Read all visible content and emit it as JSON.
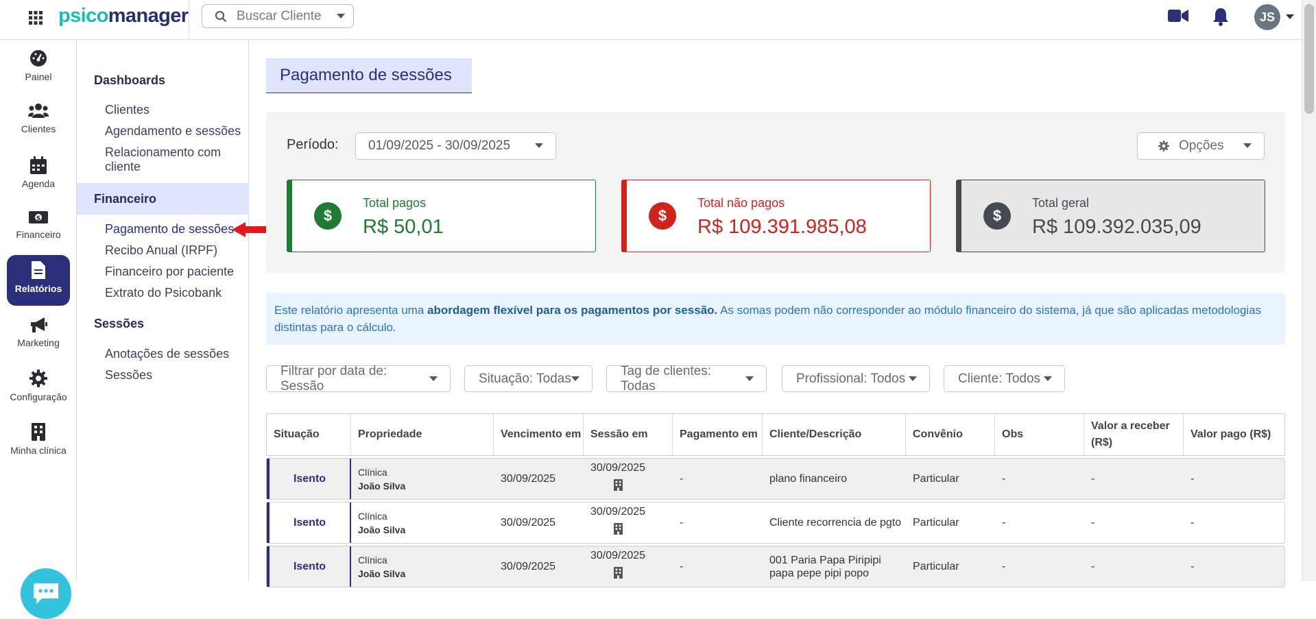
{
  "brand": {
    "part1": "psico",
    "part2": "manager"
  },
  "search": {
    "placeholder": "Buscar Cliente"
  },
  "user": {
    "initials": "JS"
  },
  "rail": [
    {
      "label": "Painel",
      "icon": "dashboard-gauge-icon"
    },
    {
      "label": "Clientes",
      "icon": "users-icon"
    },
    {
      "label": "Agenda",
      "icon": "calendar-icon"
    },
    {
      "label": "Financeiro",
      "icon": "money-icon"
    },
    {
      "label": "Relatórios",
      "icon": "report-file-icon",
      "active": true
    },
    {
      "label": "Marketing",
      "icon": "megaphone-icon"
    },
    {
      "label": "Configuração",
      "icon": "gear-icon"
    },
    {
      "label": "Minha clínica",
      "icon": "building-icon"
    }
  ],
  "subnav": {
    "dashboards": {
      "title": "Dashboards",
      "items": [
        "Clientes",
        "Agendamento e sessões",
        "Relacionamento com cliente"
      ]
    },
    "financeiro": {
      "title": "Financeiro",
      "items": [
        "Pagamento de sessões",
        "Recibo Anual (IRPF)",
        "Financeiro por paciente",
        "Extrato do Psicobank"
      ]
    },
    "sessoes": {
      "title": "Sessões",
      "items": [
        "Anotações de sessões",
        "Sessões"
      ]
    }
  },
  "page": {
    "title": "Pagamento de sessões"
  },
  "period": {
    "label": "Período:",
    "value": "01/09/2025 - 30/09/2025"
  },
  "options": {
    "label": "Opções"
  },
  "summary": {
    "paid": {
      "label": "Total pagos",
      "value": "R$ 50,01",
      "color": "#1e7b34"
    },
    "unpaid": {
      "label": "Total não pagos",
      "value": "R$ 109.391.985,08",
      "color": "#d0241b"
    },
    "total": {
      "label": "Total geral",
      "value": "R$ 109.392.035,09",
      "color": "#444a4f"
    }
  },
  "info": {
    "part1": "Este relatório apresenta uma ",
    "bold": "abordagem flexível para os pagamentos por sessão.",
    "part2": " As somas podem não corresponder ao módulo financeiro do sistema, já que são aplicadas metodologias distintas para o cálculo."
  },
  "filters": [
    "Filtrar por data de: Sessão",
    "Situação: Todas",
    "Tag de clientes: Todas",
    "Profissional: Todos",
    "Cliente: Todos"
  ],
  "table": {
    "headers": [
      "Situação",
      "Propriedade",
      "Vencimento em",
      "Sessão em",
      "Pagamento em",
      "Cliente/Descrição",
      "Convênio",
      "Obs",
      "Valor a receber (R$)",
      "Valor pago (R$)"
    ],
    "rows": [
      {
        "situacao": "Isento",
        "prop_type": "Clínica",
        "prop_name": "João Silva",
        "vencimento": "30/09/2025",
        "sessao": "30/09/2025",
        "pagamento": "-",
        "cliente": "plano financeiro",
        "convenio": "Particular",
        "obs": "-",
        "a_receber": "-",
        "pago": "-"
      },
      {
        "situacao": "Isento",
        "prop_type": "Clínica",
        "prop_name": "João Silva",
        "vencimento": "30/09/2025",
        "sessao": "30/09/2025",
        "pagamento": "-",
        "cliente": "Cliente recorrencia de pgto",
        "convenio": "Particular",
        "obs": "-",
        "a_receber": "-",
        "pago": "-"
      },
      {
        "situacao": "Isento",
        "prop_type": "Clínica",
        "prop_name": "João Silva",
        "vencimento": "30/09/2025",
        "sessao": "30/09/2025",
        "pagamento": "-",
        "cliente": "001 Paria Papa Piripipi papa pepe pipi popo",
        "convenio": "Particular",
        "obs": "-",
        "a_receber": "-",
        "pago": "-"
      }
    ]
  }
}
